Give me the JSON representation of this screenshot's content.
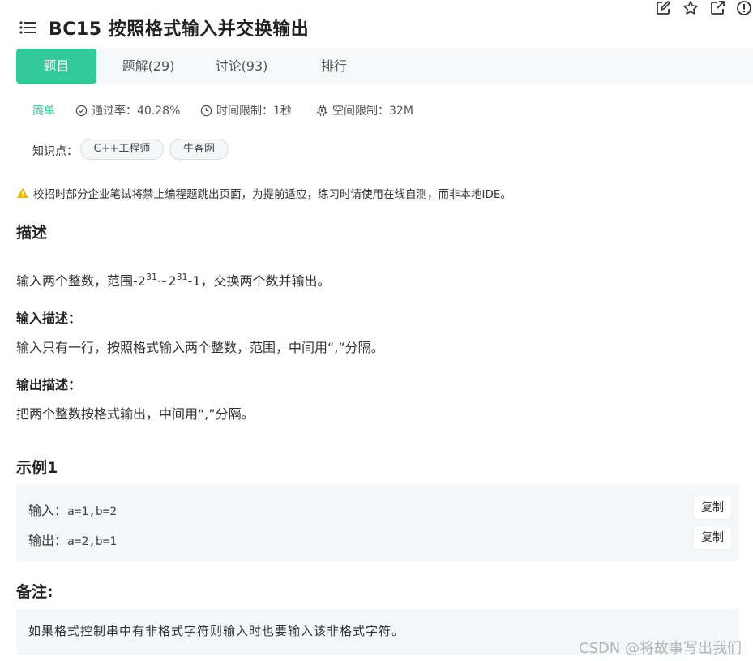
{
  "header": {
    "title": "BC15  按照格式输入并交换输出",
    "icons": [
      "edit-icon",
      "star-icon",
      "share-icon",
      "report-icon"
    ]
  },
  "tabs": [
    {
      "label": "题目",
      "active": true
    },
    {
      "label": "题解(29)",
      "active": false
    },
    {
      "label": "讨论(93)",
      "active": false
    },
    {
      "label": "排行",
      "active": false
    }
  ],
  "meta": {
    "difficulty": "简单",
    "pass_rate": "通过率：40.28%",
    "time_limit": "时间限制：1秒",
    "space_limit": "空间限制：32M"
  },
  "tags": {
    "label": "知识点：",
    "items": [
      "C++工程师",
      "牛客网"
    ]
  },
  "warning": "校招时部分企业笔试将禁止编程题跳出页面，为提前适应，练习时请使用在线自测，而非本地IDE。",
  "description": {
    "heading": "描述",
    "text_prefix": "输入两个整数，范围-2",
    "sup1": "31",
    "text_mid": "~2",
    "sup2": "31",
    "text_suffix": "-1，交换两个数并输出。",
    "input_heading": "输入描述：",
    "input_text": "输入只有一行，按照格式输入两个整数，范围，中间用“,”分隔。",
    "output_heading": "输出描述：",
    "output_text": "把两个整数按格式输出，中间用“,”分隔。"
  },
  "example": {
    "heading": "示例1",
    "input_label": "输入：",
    "input_value": "a=1,b=2",
    "output_label": "输出：",
    "output_value": "a=2,b=1",
    "copy_label": "复制"
  },
  "note": {
    "heading": "备注:",
    "text": "如果格式控制串中有非格式字符则输入时也要输入该非格式字符。"
  },
  "watermark": "CSDN @将故事写出我们",
  "colors": {
    "accent": "#32ca99",
    "warning": "#f5b800"
  }
}
